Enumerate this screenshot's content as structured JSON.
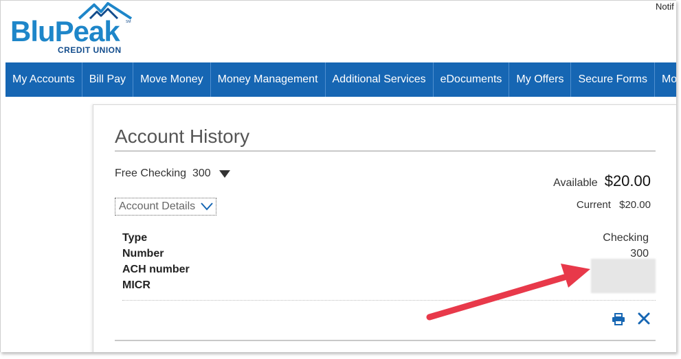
{
  "header": {
    "notif_text": "Notif",
    "logo": {
      "word": "BluPeak",
      "subtitle": "CREDIT UNION",
      "mark": "SM"
    }
  },
  "nav": {
    "items": [
      {
        "label": "My Accounts"
      },
      {
        "label": "Bill Pay"
      },
      {
        "label": "Move Money"
      },
      {
        "label": "Money Management"
      },
      {
        "label": "Additional Services"
      },
      {
        "label": "eDocuments"
      },
      {
        "label": "My Offers"
      },
      {
        "label": "Secure Forms"
      },
      {
        "label": "Mo"
      }
    ],
    "color": "#1666b3"
  },
  "main": {
    "title": "Account History",
    "account_selector": "Free Checking  300",
    "details_button": "Account Details",
    "available_label": "Available",
    "available_value": "$20.00",
    "current_label": "Current",
    "current_value": "$20.00",
    "details": [
      {
        "label": "Type",
        "value": "Checking"
      },
      {
        "label": "Number",
        "value": "300"
      },
      {
        "label": "ACH number",
        "value": ""
      },
      {
        "label": "MICR",
        "value": ""
      }
    ],
    "icons": [
      "print-icon",
      "close-icon"
    ],
    "accent_color": "#1666b3",
    "annotation_arrow_color": "#e8394a"
  }
}
